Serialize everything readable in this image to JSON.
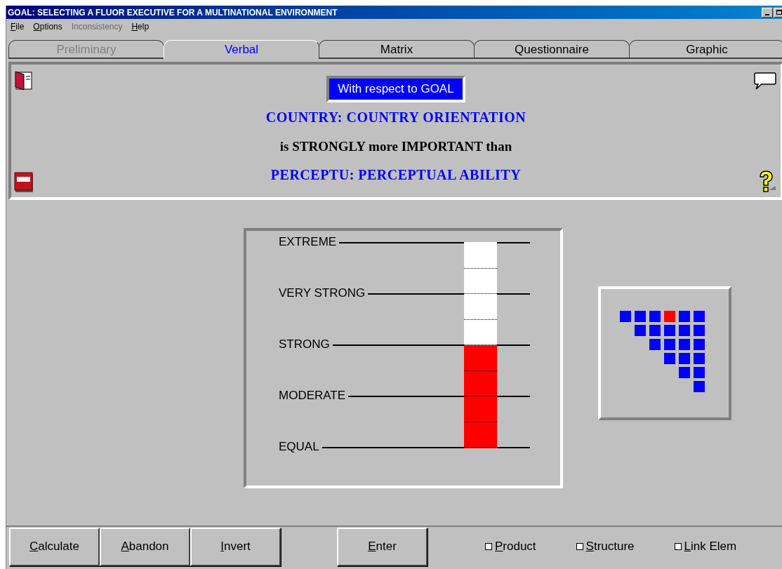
{
  "window": {
    "title": "GOAL: SELECTING A FLUOR EXECUTIVE FOR A MULTINATIONAL ENVIRONMENT"
  },
  "menu": [
    {
      "label": "File",
      "disabled": false
    },
    {
      "label": "Options",
      "disabled": false
    },
    {
      "label": "Inconsistency",
      "disabled": true
    },
    {
      "label": "Help",
      "disabled": false
    }
  ],
  "tabs": [
    {
      "label": "Preliminary",
      "selected": false,
      "disabled": true
    },
    {
      "label": "Verbal",
      "selected": true,
      "disabled": false
    },
    {
      "label": "Matrix",
      "selected": false,
      "disabled": false
    },
    {
      "label": "Questionnaire",
      "selected": false,
      "disabled": false
    },
    {
      "label": "Graphic",
      "selected": false,
      "disabled": false
    }
  ],
  "comparison": {
    "context": "With respect to GOAL",
    "first": "COUNTRY: COUNTRY ORIENTATION",
    "relation": "is STRONGLY more IMPORTANT than",
    "second": "PERCEPTU: PERCEPTUAL ABILITY"
  },
  "scale": {
    "labels": [
      "EXTREME",
      "VERY STRONG",
      "STRONG",
      "MODERATE",
      "EQUAL"
    ],
    "level": 0.5
  },
  "matrix": [
    [
      {
        "selected": false
      },
      {
        "selected": false
      },
      {
        "selected": false
      },
      {
        "selected": true
      },
      {
        "selected": false
      },
      {
        "selected": false
      }
    ],
    [
      {
        "selected": false
      },
      {
        "selected": false
      },
      {
        "selected": false
      },
      {
        "selected": false
      },
      {
        "selected": false
      }
    ],
    [
      {
        "selected": false
      },
      {
        "selected": false
      },
      {
        "selected": false
      },
      {
        "selected": false
      }
    ],
    [
      {
        "selected": false
      },
      {
        "selected": false
      },
      {
        "selected": false
      }
    ],
    [
      {
        "selected": false
      },
      {
        "selected": false
      }
    ],
    [
      {
        "selected": false
      }
    ]
  ],
  "buttons": [
    "Calculate",
    "Abandon",
    "Invert",
    "Enter"
  ],
  "options": [
    {
      "label": "Product",
      "checked": false
    },
    {
      "label": "Structure",
      "checked": false
    },
    {
      "label": "Link Elem",
      "checked": false
    }
  ]
}
